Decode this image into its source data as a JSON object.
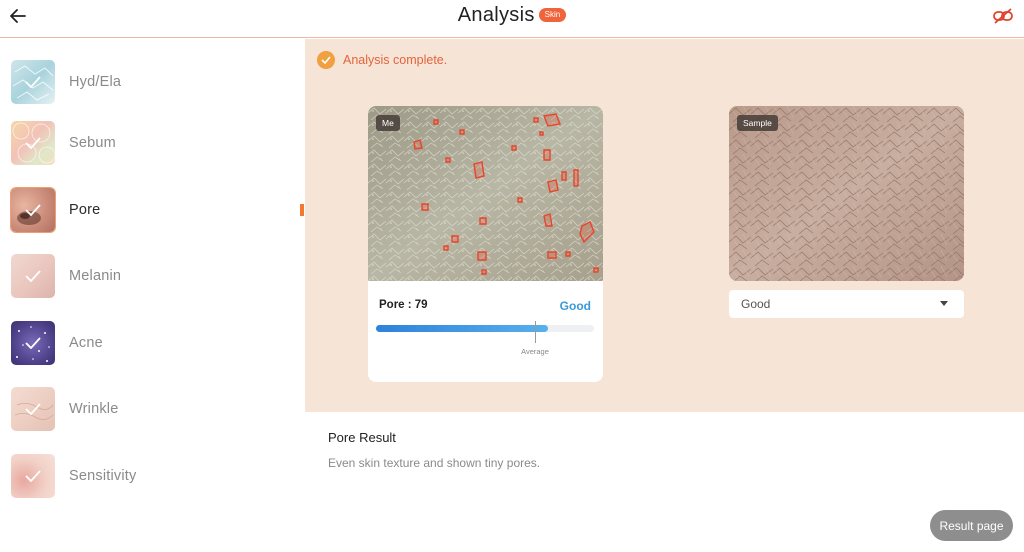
{
  "header": {
    "title": "Analysis",
    "badge": "Skin",
    "back_icon": "arrow-left-icon",
    "right_icon": "unlink-icon",
    "accent_color": "#f0643c"
  },
  "sidebar": {
    "items": [
      {
        "label": "Hyd/Ela",
        "icon": "hydration-thumbnail",
        "active": false
      },
      {
        "label": "Sebum",
        "icon": "sebum-thumbnail",
        "active": false
      },
      {
        "label": "Pore",
        "icon": "pore-thumbnail",
        "active": true
      },
      {
        "label": "Melanin",
        "icon": "melanin-thumbnail",
        "active": false
      },
      {
        "label": "Acne",
        "icon": "acne-thumbnail",
        "active": false
      },
      {
        "label": "Wrinkle",
        "icon": "wrinkle-thumbnail",
        "active": false
      },
      {
        "label": "Sensitivity",
        "icon": "sensitivity-thumbnail",
        "active": false
      }
    ]
  },
  "main": {
    "status_text": "Analysis complete.",
    "me_card": {
      "tag": "Me",
      "score_label": "Pore : 79",
      "score_value": 79,
      "grade": "Good",
      "average_label": "Average",
      "grade_color": "#3a9ad8"
    },
    "sample_card": {
      "tag": "Sample",
      "selected_grade": "Good"
    },
    "result": {
      "title": "Pore Result",
      "description": "Even skin texture and shown tiny pores."
    },
    "result_button": "Result page",
    "background_color": "#f6e4d6"
  }
}
